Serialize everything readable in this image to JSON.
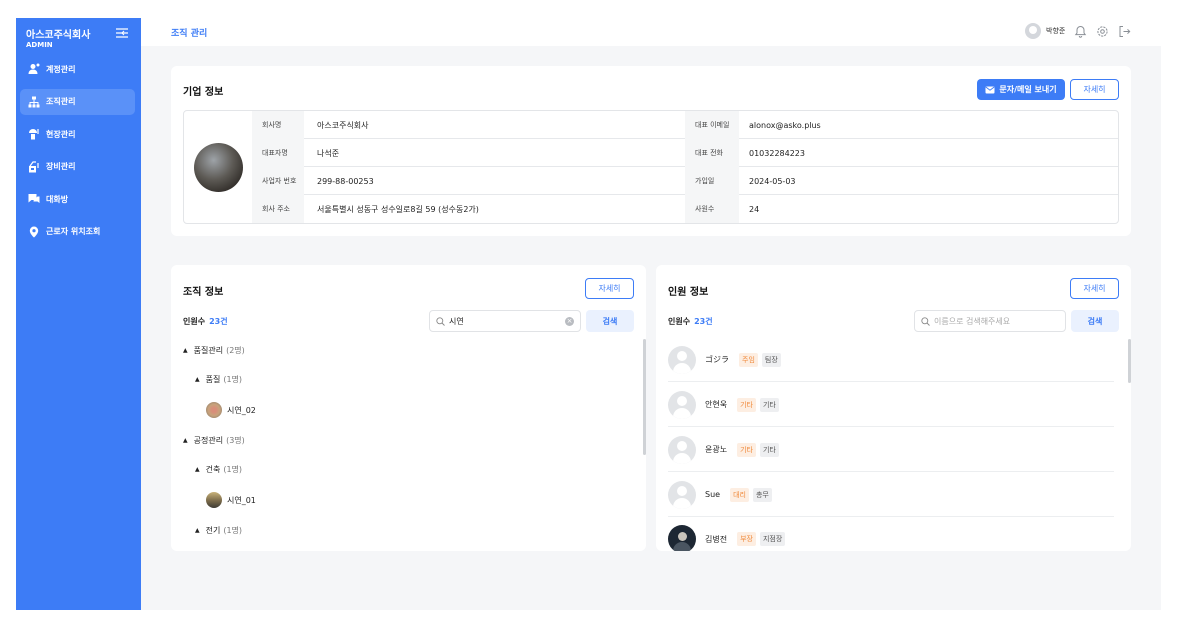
{
  "sidebar": {
    "brand": "아스코주식회사",
    "role": "ADMIN",
    "items": [
      {
        "label": "계정관리"
      },
      {
        "label": "조직관리"
      },
      {
        "label": "현장관리"
      },
      {
        "label": "장비관리"
      },
      {
        "label": "대화방"
      },
      {
        "label": "근로자 위치조회"
      }
    ]
  },
  "topbar": {
    "breadcrumb": "조직 관리",
    "user_name": "박향준"
  },
  "company": {
    "title": "기업 정보",
    "send_button": "문자/메일 보내기",
    "detail_button": "자세히",
    "rows": [
      {
        "label_left": "회사명",
        "value_left": "아스코주식회사",
        "label_right": "대표 이메일",
        "value_right": "alonox@asko.plus"
      },
      {
        "label_left": "대표자명",
        "value_left": "나석준",
        "label_right": "대표 전화",
        "value_right": "01032284223"
      },
      {
        "label_left": "사업자 번호",
        "value_left": "299-88-00253",
        "label_right": "가입일",
        "value_right": "2024-05-03"
      },
      {
        "label_left": "회사 주소",
        "value_left": "서울특별시 성동구 성수일로8길 59 (성수동2가)",
        "label_right": "사원수",
        "value_right": "24"
      }
    ]
  },
  "org": {
    "title": "조직 정보",
    "detail_button": "자세히",
    "count_label": "인원수",
    "count_value": "23건",
    "search_value": "시연",
    "search_button": "검색",
    "tree": [
      {
        "name": "품질관리",
        "count": "(2명)",
        "type": "group",
        "level": 0
      },
      {
        "name": "품질",
        "count": "(1명)",
        "type": "group",
        "level": 1
      },
      {
        "name": "시연_02",
        "count": "",
        "type": "member",
        "level": 2
      },
      {
        "name": "공정관리",
        "count": "(3명)",
        "type": "group",
        "level": 0
      },
      {
        "name": "건축",
        "count": "(1명)",
        "type": "group",
        "level": 1
      },
      {
        "name": "시연_01",
        "count": "",
        "type": "member",
        "level": 2
      },
      {
        "name": "전기",
        "count": "(1명)",
        "type": "group",
        "level": 1
      }
    ]
  },
  "people": {
    "title": "인원 정보",
    "detail_button": "자세히",
    "count_label": "인원수",
    "count_value": "23건",
    "search_placeholder": "이름으로 검색해주세요",
    "search_button": "검색",
    "list": [
      {
        "name": "ゴジラ",
        "tag1": "주임",
        "tag2": "팀장"
      },
      {
        "name": "안현욱",
        "tag1": "기타",
        "tag2": "기타"
      },
      {
        "name": "윤광노",
        "tag1": "기타",
        "tag2": "기타"
      },
      {
        "name": "Sue",
        "tag1": "대리",
        "tag2": "총무"
      },
      {
        "name": "김병전",
        "tag1": "부장",
        "tag2": "지점장"
      }
    ]
  },
  "colors": {
    "primary": "#3d7cf6",
    "tag_orange": "#f08a3c"
  }
}
